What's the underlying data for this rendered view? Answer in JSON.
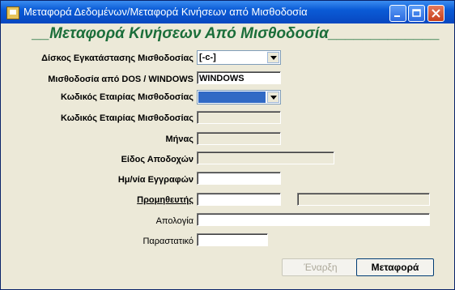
{
  "window": {
    "title": "Μεταφορά Δεδομένων/Μεταφορά Κινήσεων από Μισθοδοσία",
    "icons": {
      "app": "app-icon",
      "minimize": "minimize-icon",
      "maximize": "maximize-icon",
      "close": "close-icon"
    }
  },
  "header": {
    "title": "__Μεταφορά Κινήσεων Από Μισθοδοσία_____________"
  },
  "fields": {
    "disk": {
      "label": "Δίσκος Εγκατάστασης Μισθοδοσίας",
      "value": "[-c-]"
    },
    "platform": {
      "label": "Μισθοδοσία από DOS / WINDOWS",
      "value": "WINDOWS"
    },
    "company_code": {
      "label": "Κωδικός Εταιρίας Μισθοδοσίας",
      "value": ""
    },
    "company_code2": {
      "label": "Κωδικός Εταιρίας Μισθοδοσίας",
      "value": ""
    },
    "month": {
      "label": "Μήνας",
      "value": ""
    },
    "earnings_type": {
      "label": "Είδος Αποδοχών",
      "value": ""
    },
    "entry_date": {
      "label": "Ημ/νία Εγγραφών",
      "value": ""
    },
    "supplier": {
      "label": "Προμηθευτής",
      "value": "",
      "name_value": ""
    },
    "reason": {
      "label": "Απολογία",
      "value": ""
    },
    "document": {
      "label": "Παραστατικό",
      "value": ""
    }
  },
  "buttons": {
    "start": "Έναρξη",
    "transfer": "Μεταφορά"
  },
  "colors": {
    "titlebar": "#0A5BD6",
    "header_green": "#1B6E3A",
    "selection": "#316AC5"
  }
}
